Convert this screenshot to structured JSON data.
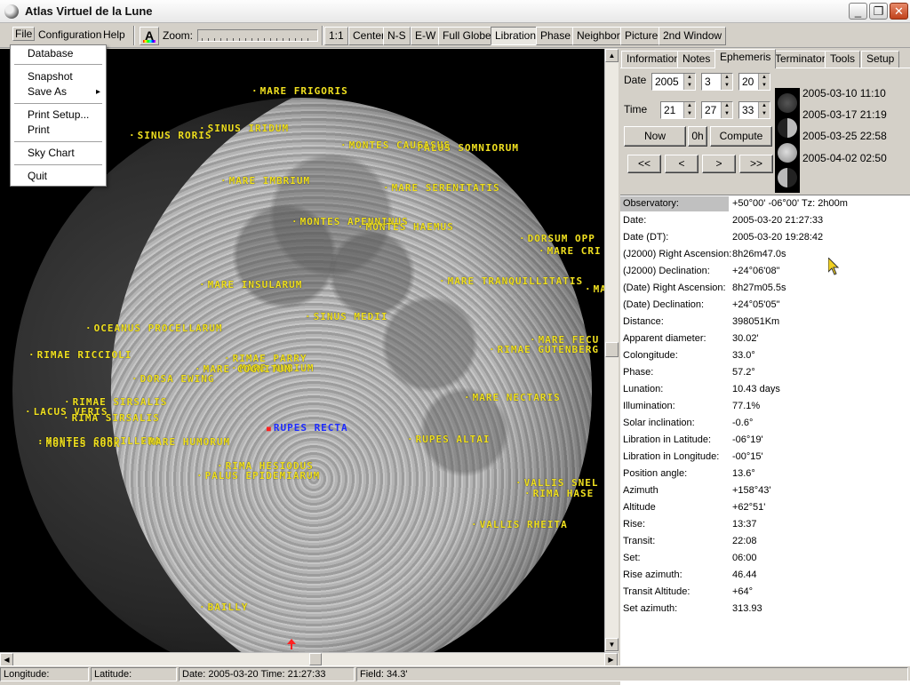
{
  "window": {
    "title": "Atlas Virtuel de la Lune"
  },
  "menu": {
    "file": "File",
    "configuration": "Configuration",
    "help": "Help"
  },
  "toolbar": {
    "zoom_label": "Zoom:",
    "buttons": [
      "1:1",
      "Center",
      "N-S",
      "E-W",
      "Full Globe",
      "Libration",
      "Phase",
      "Neighbor",
      "Picture",
      "2nd Window"
    ]
  },
  "file_menu": [
    "Database",
    "Snapshot",
    "Save As",
    "Print Setup...",
    "Print",
    "Sky Chart",
    "Quit"
  ],
  "map_features": [
    "MARE FRIGORIS",
    "SINUS IRIDUM",
    "SINUS RORIS",
    "MONTES CAUCASUS",
    "PALUS SOMNIORUM",
    "MARE IMBRIUM",
    "MARE SERENITATIS",
    "MONTES APENNINUS",
    "MONTES HAEMUS",
    "DORSUM OPP",
    "MARE CRI",
    "MARE INSULARUM",
    "MARE TRANQUILLITATIS",
    "MA",
    "SINUS MEDII",
    "OCEANUS PROCELLARUM",
    "MARE FECU",
    "RIMAE RICCIOLI",
    "RIMAE GUTENBERG",
    "RIMAE PARRY",
    "MARE NUBIUM",
    "MARE COGNITUM",
    "DORSA EWING",
    "MARE NECTARIS",
    "RIMAE SIRSALIS",
    "LACUS VERIS",
    "RIMA SIRSALIS",
    "RUPES RECTA",
    "MONTES CORDILLERA",
    "MARE HUMORUM",
    "MONTES ROOK",
    "RUPES ALTAI",
    "RIMA HESIODUS",
    "PALUS EPIDEMIARUM",
    "VALLIS SNEL",
    "RIMA HASE",
    "VALLIS RHEITA",
    "BAILLY"
  ],
  "tabs": [
    "Information",
    "Notes",
    "Ephemeris",
    "Terminator",
    "Tools",
    "Setup"
  ],
  "active_tab": "Ephemeris",
  "ephemeris": {
    "date_label": "Date",
    "time_label": "Time",
    "year": "2005",
    "month": "3",
    "day": "20",
    "hour": "21",
    "minute": "27",
    "second": "33",
    "now_button": "Now",
    "zero_h_button": "0h",
    "compute_button": "Compute",
    "nav": [
      "<<",
      "<",
      ">",
      ">>"
    ],
    "phase_dates": [
      "2005-03-10 11:10",
      "2005-03-17 21:19",
      "2005-03-25 22:58",
      "2005-04-02 02:50"
    ],
    "rows": [
      {
        "k": "Observatory:",
        "v": "+50°00' -06°00' Tz:  2h00m"
      },
      {
        "k": "Date:",
        "v": "2005-03-20 21:27:33"
      },
      {
        "k": "Date (DT):",
        "v": "2005-03-20 19:28:42"
      },
      {
        "k": "(J2000) Right Ascension:",
        "v": "  8h26m47.0s"
      },
      {
        "k": "(J2000) Declination:",
        "v": "+24°06'08\""
      },
      {
        "k": "(Date) Right Ascension:",
        "v": "  8h27m05.5s"
      },
      {
        "k": "(Date) Declination:",
        "v": "+24°05'05\""
      },
      {
        "k": "Distance:",
        "v": "398051Km"
      },
      {
        "k": "Apparent diameter:",
        "v": "30.02'"
      },
      {
        "k": "Colongitude:",
        "v": "33.0°"
      },
      {
        "k": "Phase:",
        "v": "57.2°"
      },
      {
        "k": "Lunation:",
        "v": "10.43 days"
      },
      {
        "k": "Illumination:",
        "v": "77.1%"
      },
      {
        "k": "Solar inclination:",
        "v": "-0.6°"
      },
      {
        "k": "Libration in Latitude:",
        "v": "-06°19'"
      },
      {
        "k": "Libration in Longitude:",
        "v": "-00°15'"
      },
      {
        "k": "Position angle:",
        "v": "13.6°"
      },
      {
        "k": "Azimuth",
        "v": "+158°43'"
      },
      {
        "k": "Altitude",
        "v": "+62°51'"
      },
      {
        "k": "Rise:",
        "v": "13:37"
      },
      {
        "k": "Transit:",
        "v": "22:08"
      },
      {
        "k": "Set:",
        "v": "06:00"
      },
      {
        "k": "Rise azimuth:",
        "v": " 46.44"
      },
      {
        "k": "Transit Altitude:",
        "v": "+64°"
      },
      {
        "k": "Set azimuth:",
        "v": "313.93"
      }
    ]
  },
  "status": {
    "longitude": "Longitude:",
    "latitude": "Latitude:",
    "datetime": "Date: 2005-03-20   Time: 21:27:33",
    "field": "Field: 34.3'"
  }
}
